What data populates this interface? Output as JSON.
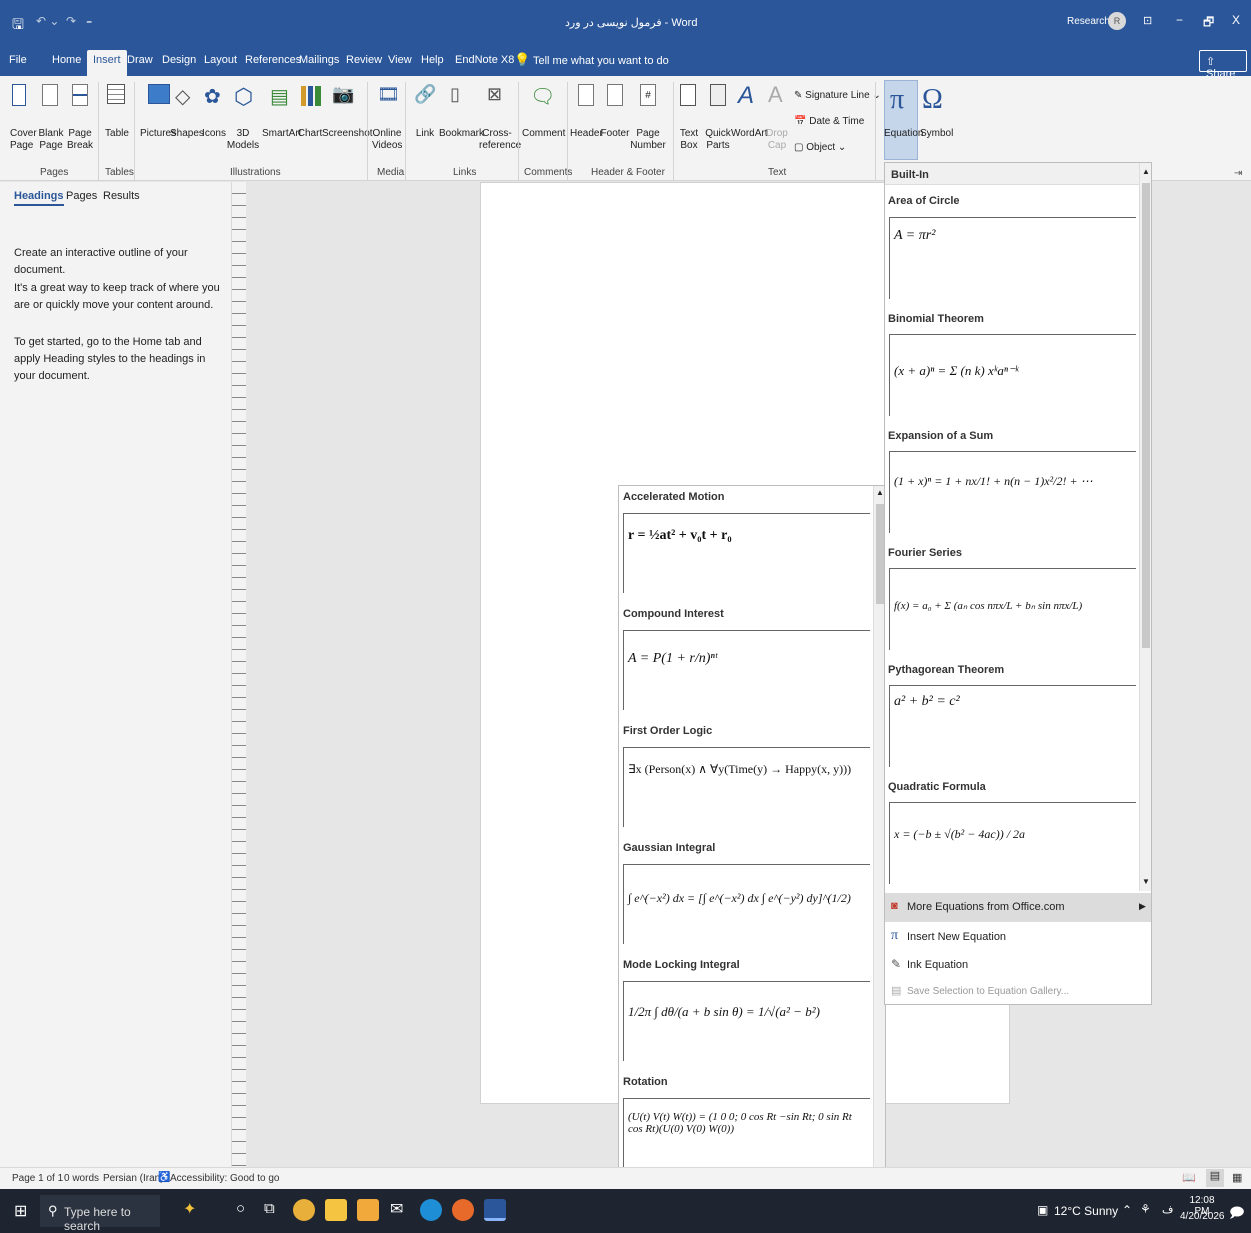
{
  "titlebar": {
    "title": "فرمول نویسی در ورد - Word",
    "account": "Research02",
    "account_initial": "R",
    "minimize": "−",
    "restore": "🗗",
    "close": "X"
  },
  "tabs": [
    "File",
    "Home",
    "Insert",
    "Draw",
    "Design",
    "Layout",
    "References",
    "Mailings",
    "Review",
    "View",
    "Help",
    "EndNote X8"
  ],
  "active_tab": "Insert",
  "tell_me": "Tell me what you want to do",
  "share": "Share",
  "ribbon": {
    "cover_page": "Cover Page",
    "blank_page": "Blank Page",
    "page_break": "Page Break",
    "table": "Table",
    "pictures": "Pictures",
    "shapes": "Shapes",
    "icons": "Icons",
    "models_3d": "3D Models",
    "smartart": "SmartArt",
    "chart": "Chart",
    "screenshot": "Screenshot",
    "online_videos": "Online Videos",
    "link": "Link",
    "bookmark": "Bookmark",
    "cross_reference": "Cross-reference",
    "comment": "Comment",
    "header": "Header",
    "footer": "Footer",
    "page_number": "Page Number",
    "text_box": "Text Box",
    "quick_parts": "Quick Parts",
    "wordart": "WordArt",
    "drop_cap": "Drop Cap",
    "signature_line": "Signature Line",
    "date_time": "Date & Time",
    "object": "Object",
    "equation": "Equation",
    "symbol": "Symbol",
    "groups": {
      "pages": "Pages",
      "tables": "Tables",
      "illustrations": "Illustrations",
      "media": "Media",
      "links": "Links",
      "comments": "Comments",
      "header_footer": "Header & Footer",
      "text": "Text"
    }
  },
  "navpane": {
    "tabs": [
      "Headings",
      "Pages",
      "Results"
    ],
    "p1": "Create an interactive outline of your document.",
    "p2": "It's a great way to keep track of where you are or quickly move your content around.",
    "p3": "To get started, go to the Home tab and apply Heading styles to the headings in your document."
  },
  "builtin_gallery": {
    "header": "Built-In",
    "items": [
      {
        "name": "Area of Circle",
        "formula": "A = πr²"
      },
      {
        "name": "Binomial Theorem",
        "formula": "(x + a)ⁿ = Σ (n k) xᵏaⁿ⁻ᵏ"
      },
      {
        "name": "Expansion of a Sum",
        "formula": "(1 + x)ⁿ = 1 + nx/1! + n(n − 1)x²/2! + ⋯"
      },
      {
        "name": "Fourier Series",
        "formula": "f(x) = a₀ + Σ (aₙ cos nπx/L + bₙ sin nπx/L)"
      },
      {
        "name": "Pythagorean Theorem",
        "formula": "a² + b² = c²"
      },
      {
        "name": "Quadratic Formula",
        "formula": "x = (−b ± √(b² − 4ac)) / 2a"
      }
    ],
    "menu": [
      {
        "label": "More Equations from Office.com",
        "icon": "office-icon"
      },
      {
        "label": "Insert New Equation",
        "icon": "pi-icon"
      },
      {
        "label": "Ink Equation",
        "icon": "ink-icon"
      },
      {
        "label": "Save Selection to Equation Gallery...",
        "icon": "save-gallery-icon"
      }
    ]
  },
  "office_gallery": {
    "items": [
      {
        "name": "Accelerated Motion",
        "formula": "r = ½at² + v₀t + r₀"
      },
      {
        "name": "Compound Interest",
        "formula": "A = P(1 + r/n)ⁿᵗ"
      },
      {
        "name": "First Order Logic",
        "formula": "∃x (Person(x) ∧ ∀y(Time(y) → Happy(x, y)))"
      },
      {
        "name": "Gaussian Integral",
        "formula": "∫ e^(−x²) dx = [∫ e^(−x²) dx ∫ e^(−y²) dy]^(1/2)"
      },
      {
        "name": "Mode Locking Integral",
        "formula": "1/2π ∫ dθ/(a + b sin θ) = 1/√(a² − b²)"
      },
      {
        "name": "Rotation",
        "formula": "(U(t) V(t) W(t)) = (1 0 0; 0 cos Rt −sin Rt; 0 sin Rt cos Rt)(U(0) V(0) W(0))"
      }
    ]
  },
  "statusbar": {
    "page": "Page 1 of 1",
    "words": "0 words",
    "language": "Persian (Iran)",
    "accessibility": "Accessibility: Good to go"
  },
  "taskbar": {
    "search_placeholder": "Type here to search",
    "weather": "12°C Sunny",
    "time": "12:08 PM",
    "date": "4/20/2026"
  }
}
